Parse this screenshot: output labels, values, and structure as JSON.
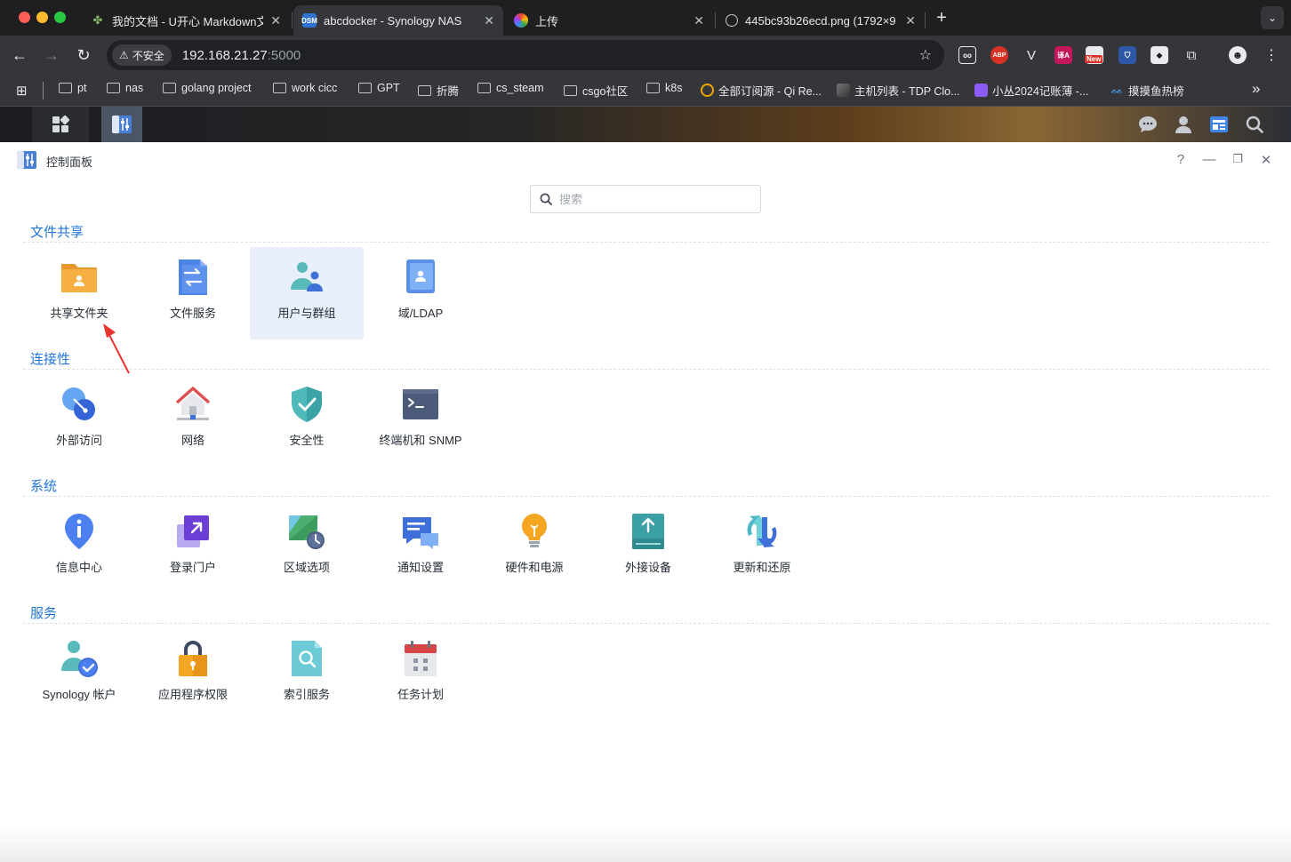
{
  "browser": {
    "tabs": [
      {
        "title": "我的文档 - U开心 Markdown文",
        "active": false
      },
      {
        "title": "abcdocker - Synology NAS",
        "active": true
      },
      {
        "title": "上传",
        "active": false
      },
      {
        "title": "445bc93b26ecd.png (1792×9",
        "active": false
      }
    ],
    "dsm_favicon": "DSM",
    "security_label": "不安全",
    "url_host": "192.168.21.27",
    "url_port": ":5000",
    "extensions": {
      "abp": "ABP",
      "translate": "译A",
      "new_badge": "New"
    },
    "bookmarks": [
      {
        "label": "pt",
        "type": "folder"
      },
      {
        "label": "nas",
        "type": "folder"
      },
      {
        "label": "golang project",
        "type": "folder"
      },
      {
        "label": "work cicc",
        "type": "folder"
      },
      {
        "label": "GPT",
        "type": "folder"
      },
      {
        "label": "折腾",
        "type": "folder"
      },
      {
        "label": "cs_steam",
        "type": "folder"
      },
      {
        "label": "csgo社区",
        "type": "folder"
      },
      {
        "label": "k8s",
        "type": "folder"
      },
      {
        "label": "全部订阅源 - Qi Re...",
        "type": "site"
      },
      {
        "label": "主机列表 - TDP Clo...",
        "type": "site"
      },
      {
        "label": "小丛2024记账薄 -...",
        "type": "site"
      },
      {
        "label": "摸摸鱼热榜",
        "type": "site"
      }
    ],
    "overflow_label": "»"
  },
  "window": {
    "title": "控制面板",
    "help": "?"
  },
  "search": {
    "placeholder": "搜索"
  },
  "sections": [
    {
      "title": "文件共享",
      "items": [
        {
          "label": "共享文件夹",
          "icon": "shared-folder-icon"
        },
        {
          "label": "文件服务",
          "icon": "file-services-icon"
        },
        {
          "label": "用户与群组",
          "icon": "user-group-icon",
          "selected": true
        },
        {
          "label": "域/LDAP",
          "icon": "domain-ldap-icon"
        }
      ]
    },
    {
      "title": "连接性",
      "items": [
        {
          "label": "外部访问",
          "icon": "external-access-icon"
        },
        {
          "label": "网络",
          "icon": "network-icon"
        },
        {
          "label": "安全性",
          "icon": "security-shield-icon"
        },
        {
          "label": "终端机和 SNMP",
          "icon": "terminal-icon"
        }
      ]
    },
    {
      "title": "系统",
      "items": [
        {
          "label": "信息中心",
          "icon": "info-center-icon"
        },
        {
          "label": "登录门户",
          "icon": "login-portal-icon"
        },
        {
          "label": "区域选项",
          "icon": "regional-options-icon"
        },
        {
          "label": "通知设置",
          "icon": "notification-icon"
        },
        {
          "label": "硬件和电源",
          "icon": "hardware-power-icon"
        },
        {
          "label": "外接设备",
          "icon": "external-devices-icon"
        },
        {
          "label": "更新和还原",
          "icon": "update-restore-icon"
        }
      ]
    },
    {
      "title": "服务",
      "items": [
        {
          "label": "Synology 帐户",
          "icon": "synology-account-icon"
        },
        {
          "label": "应用程序权限",
          "icon": "app-privileges-icon"
        },
        {
          "label": "索引服务",
          "icon": "indexing-service-icon"
        },
        {
          "label": "任务计划",
          "icon": "task-scheduler-icon"
        }
      ]
    }
  ],
  "colors": {
    "accent": "#1f75d8",
    "selected_bg": "#e8effa"
  }
}
